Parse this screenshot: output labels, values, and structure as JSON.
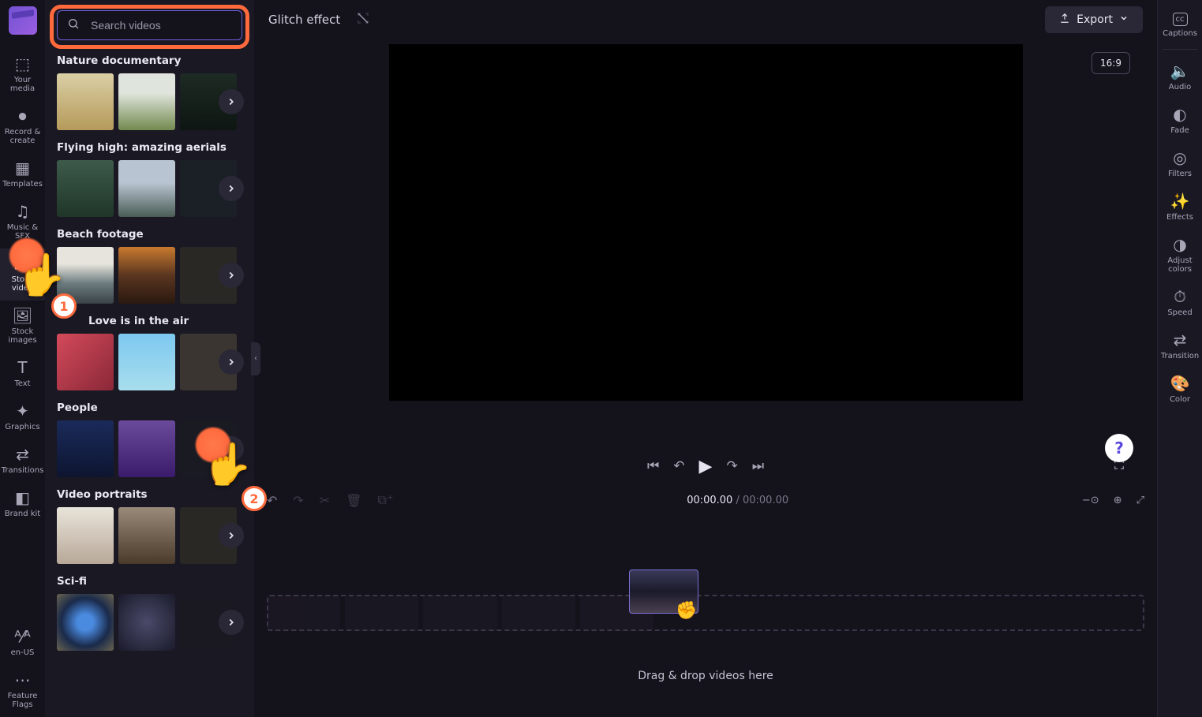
{
  "leftnav": {
    "items": [
      {
        "label": "Your media",
        "icon": "⬚"
      },
      {
        "label": "Record & create",
        "icon": "⏺"
      },
      {
        "label": "Templates",
        "icon": "▦"
      },
      {
        "label": "Music & SFX",
        "icon": "♫"
      },
      {
        "label": "Stock video",
        "icon": "🎞"
      },
      {
        "label": "Stock images",
        "icon": "🖼"
      },
      {
        "label": "Text",
        "icon": "T"
      },
      {
        "label": "Graphics",
        "icon": "✦"
      },
      {
        "label": "Transitions",
        "icon": "⇄"
      },
      {
        "label": "Brand kit",
        "icon": "◧"
      }
    ],
    "bottom": [
      {
        "label": "en-US",
        "icon": "ᴬ⁄ᴬ"
      },
      {
        "label": "Feature Flags",
        "icon": "⋯"
      }
    ]
  },
  "stock_panel": {
    "search_placeholder": "Search videos",
    "categories": [
      {
        "title": "Nature documentary"
      },
      {
        "title": "Flying high: amazing aerials"
      },
      {
        "title": "Beach footage"
      },
      {
        "title": "Love is in the air"
      },
      {
        "title": "People"
      },
      {
        "title": "Video portraits"
      },
      {
        "title": "Sci-fi"
      }
    ]
  },
  "topbar": {
    "project_title": "Glitch effect",
    "export_label": "Export"
  },
  "preview": {
    "aspect_label": "16:9"
  },
  "timeline": {
    "timecode_current": "00:00.00",
    "timecode_duration": "00:00.00",
    "drop_hint": "Drag & drop videos here"
  },
  "rightnav": {
    "items": [
      {
        "label": "Captions",
        "icon": "cc"
      },
      {
        "label": "Audio",
        "icon": "🔈"
      },
      {
        "label": "Fade",
        "icon": "◐"
      },
      {
        "label": "Filters",
        "icon": "◎"
      },
      {
        "label": "Effects",
        "icon": "✨"
      },
      {
        "label": "Adjust colors",
        "icon": "◑"
      },
      {
        "label": "Speed",
        "icon": "⏱"
      },
      {
        "label": "Transition",
        "icon": "⇄"
      },
      {
        "label": "Color",
        "icon": "🎨"
      }
    ]
  },
  "annotations": {
    "step1": "1",
    "step2": "2"
  }
}
